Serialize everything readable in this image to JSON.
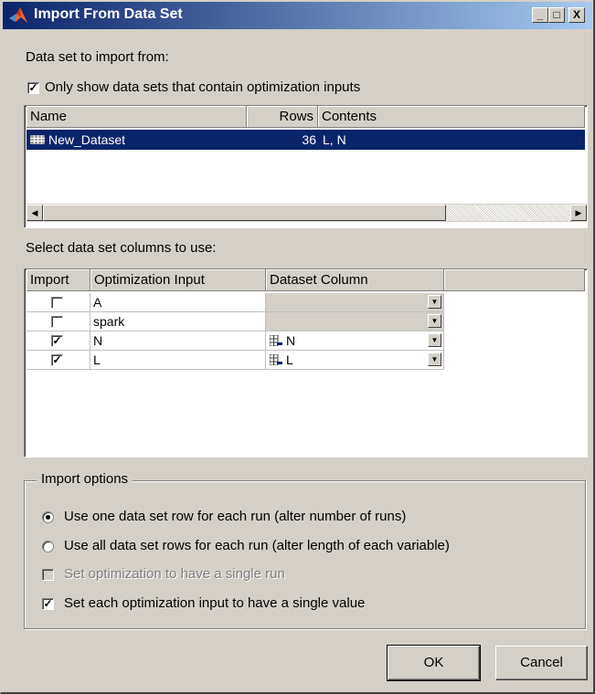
{
  "window": {
    "title": "Import From Data Set",
    "controls": {
      "minimize": "_",
      "maximize": "□",
      "close": "X"
    }
  },
  "dataset_section": {
    "label": "Data set to import from:",
    "filter_checkbox": {
      "label": "Only show data sets that contain optimization inputs",
      "checked": true
    },
    "columns": [
      "Name",
      "Rows",
      "Contents"
    ],
    "rows": [
      {
        "name": "New_Dataset",
        "rows": "36",
        "contents": "L, N",
        "selected": true
      }
    ]
  },
  "columns_section": {
    "label": "Select data set columns to use:",
    "headers": [
      "Import",
      "Optimization Input",
      "Dataset Column"
    ],
    "rows": [
      {
        "import": false,
        "input": "A",
        "column": "",
        "enabled": false
      },
      {
        "import": false,
        "input": "spark",
        "column": "",
        "enabled": false
      },
      {
        "import": true,
        "input": "N",
        "column": "N",
        "enabled": true
      },
      {
        "import": true,
        "input": "L",
        "column": "L",
        "enabled": true
      }
    ]
  },
  "import_options": {
    "legend": "Import options",
    "radio_one_row": {
      "label": "Use one data set row for each run (alter number of runs)",
      "selected": true
    },
    "radio_all_rows": {
      "label": "Use all data set rows for each run (alter length of each variable)",
      "selected": false
    },
    "single_run": {
      "label": "Set optimization to have a single run",
      "checked": false,
      "enabled": false
    },
    "single_value": {
      "label": "Set each optimization input to have a single value",
      "checked": true
    }
  },
  "buttons": {
    "ok": "OK",
    "cancel": "Cancel"
  },
  "colors": {
    "title_start": "#0a246a",
    "title_end": "#a6caf0",
    "selection": "#0a246a",
    "face": "#d4d0c8"
  }
}
